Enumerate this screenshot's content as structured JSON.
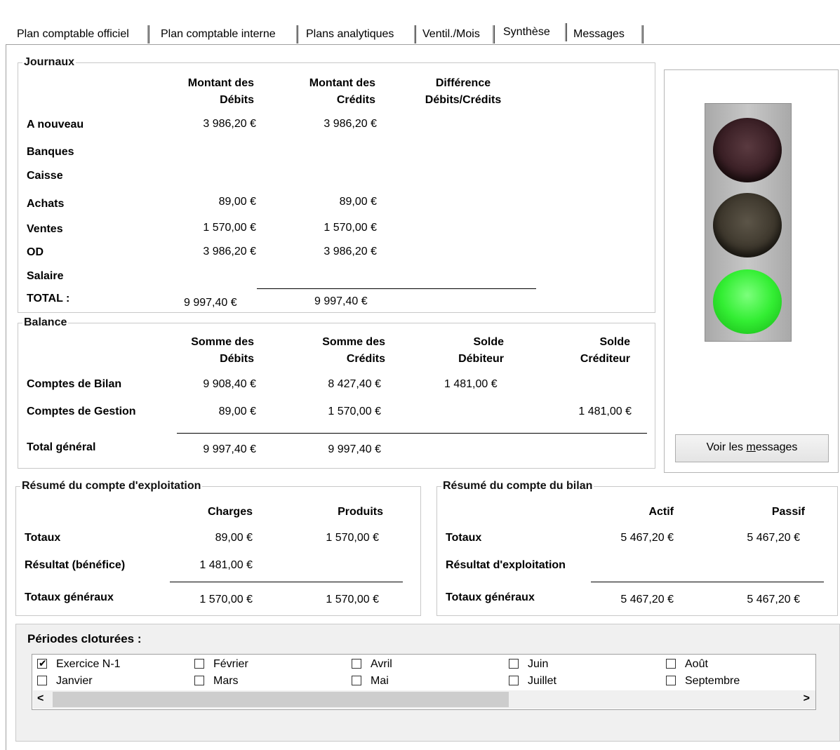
{
  "tabs": [
    "Plan comptable officiel",
    "Plan comptable interne",
    "Plans analytiques",
    "Ventil./Mois",
    "Synthèse",
    "Messages"
  ],
  "journaux": {
    "legend": "Journaux",
    "headers": {
      "debits_1": "Montant des",
      "debits_2": "Débits",
      "credits_1": "Montant des",
      "credits_2": "Crédits",
      "diff_1": "Différence",
      "diff_2": "Débits/Crédits"
    },
    "rows": [
      {
        "label": "A nouveau",
        "debit": "3 986,20 €",
        "credit": "3 986,20 €"
      },
      {
        "label": "Banques",
        "debit": "",
        "credit": ""
      },
      {
        "label": "Caisse",
        "debit": "",
        "credit": ""
      },
      {
        "label": "Achats",
        "debit": "89,00 €",
        "credit": "89,00 €"
      },
      {
        "label": "Ventes",
        "debit": "1 570,00 €",
        "credit": "1 570,00 €"
      },
      {
        "label": "OD",
        "debit": "3 986,20 €",
        "credit": "3 986,20 €"
      },
      {
        "label": "Salaire",
        "debit": "",
        "credit": ""
      }
    ],
    "total": {
      "label": "TOTAL :",
      "debit": "9 997,40 €",
      "credit": "9 997,40 €"
    }
  },
  "balance": {
    "legend": "Balance",
    "headers": {
      "debits_1": "Somme des",
      "debits_2": "Débits",
      "credits_1": "Somme des",
      "credits_2": "Crédits",
      "sd_1": "Solde",
      "sd_2": "Débiteur",
      "sc_1": "Solde",
      "sc_2": "Créditeur"
    },
    "rows": [
      {
        "label": "Comptes de Bilan",
        "debit": "9 908,40 €",
        "credit": "8 427,40 €",
        "solde_debiteur": "1 481,00 €",
        "solde_crediteur": ""
      },
      {
        "label": "Comptes de Gestion",
        "debit": "89,00 €",
        "credit": "1 570,00 €",
        "solde_debiteur": "",
        "solde_crediteur": "1 481,00 €"
      }
    ],
    "total": {
      "label": "Total général",
      "debit": "9 997,40 €",
      "credit": "9 997,40 €"
    }
  },
  "exploitation": {
    "legend": "Résumé du compte d'exploitation",
    "h_charges": "Charges",
    "h_produits": "Produits",
    "totaux_label": "Totaux",
    "totaux_charges": "89,00 €",
    "totaux_produits": "1 570,00 €",
    "resultat_label": "Résultat (bénéfice)",
    "resultat_charges": "1 481,00 €",
    "generaux_label": "Totaux généraux",
    "generaux_charges": "1 570,00 €",
    "generaux_produits": "1 570,00 €"
  },
  "bilan": {
    "legend": "Résumé du compte du bilan",
    "h_actif": "Actif",
    "h_passif": "Passif",
    "totaux_label": "Totaux",
    "totaux_actif": "5 467,20 €",
    "totaux_passif": "5 467,20 €",
    "resultat_label": "Résultat d'exploitation",
    "generaux_label": "Totaux généraux",
    "generaux_actif": "5 467,20 €",
    "generaux_passif": "5 467,20 €"
  },
  "status_light": {
    "active": "green",
    "colors": {
      "red_off": "#4a2a2e",
      "yellow_off": "#4a4438",
      "green_on": "#33ee33"
    }
  },
  "messages_button": {
    "pre": "Voir les ",
    "mnemonic": "m",
    "post": "essages"
  },
  "periodes": {
    "title": "Périodes cloturées :",
    "items": [
      {
        "label": "Exercice N-1",
        "checked": true
      },
      {
        "label": "Janvier",
        "checked": false
      },
      {
        "label": "Février",
        "checked": false
      },
      {
        "label": "Mars",
        "checked": false
      },
      {
        "label": "Avril",
        "checked": false
      },
      {
        "label": "Mai",
        "checked": false
      },
      {
        "label": "Juin",
        "checked": false
      },
      {
        "label": "Juillet",
        "checked": false
      },
      {
        "label": "Août",
        "checked": false
      },
      {
        "label": "Septembre",
        "checked": false
      }
    ],
    "scroll_left": "<",
    "scroll_right": ">"
  }
}
